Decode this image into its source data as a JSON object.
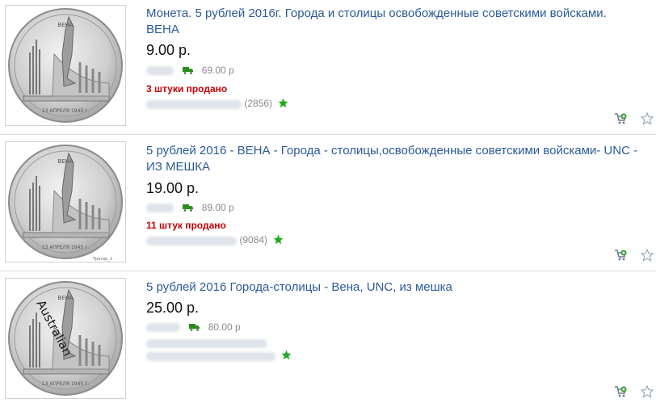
{
  "listings": [
    {
      "title": "Монета. 5 рублей 2016г. Города и столицы освобожденные советскими войсками. ВЕНА",
      "price": "9.00 р.",
      "shipping": "69.00 р",
      "sold": "3 штуки продано",
      "rating": "(2856)",
      "coin_top": "ВЕНА",
      "coin_date": "13 АПРЕЛЯ 1945 г."
    },
    {
      "title": "5 рублей 2016 - ВЕНА - Города - столицы,освобожденные советскими войсками- UNC - ИЗ МЕШКА",
      "price": "19.00 р.",
      "shipping": "89.00 р",
      "sold": "11 штук продано",
      "rating": "(9084)",
      "coin_top": "ВЕНА",
      "coin_date": "13 АПРЕЛЯ 1945 г.",
      "watermark": "Третир_1"
    },
    {
      "title": "5 рублей 2016 Города-столицы - Вена, UNC, из мешка",
      "price": "25.00 р.",
      "shipping": "80.00 р",
      "coin_top": "ВЕНА",
      "coin_date": "13 АПРЕЛЯ 1945 г.",
      "watermark": "Australian"
    }
  ],
  "icons": {
    "cart": "add-to-cart-icon",
    "watch": "watch-star-icon",
    "truck": "truck-icon",
    "seller_star": "green-star-icon"
  },
  "colors": {
    "title": "#2a5a9a",
    "sold": "#c40000",
    "truck": "#2e8b1f",
    "star": "#22aa22"
  }
}
